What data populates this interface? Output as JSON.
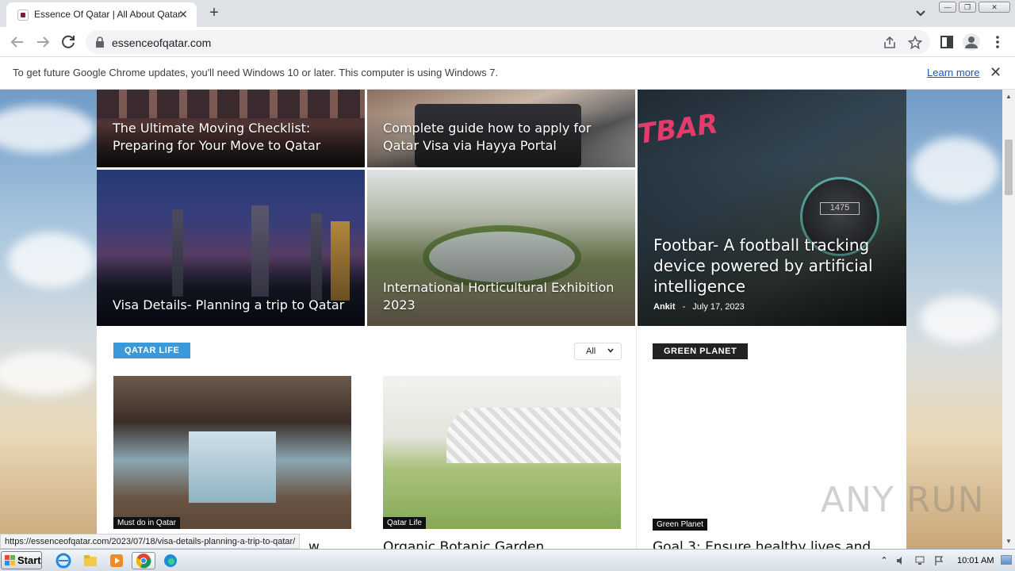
{
  "browser": {
    "tab": {
      "title": "Essence Of Qatar | All About Qatar",
      "close": "✕"
    },
    "new_tab": "+",
    "window_buttons": {
      "minimize": "—",
      "restore": "❐",
      "close": "✕"
    },
    "address": "essenceofqatar.com"
  },
  "infobar": {
    "message": "To get future Google Chrome updates, you'll need Windows 10 or later. This computer is using Windows 7.",
    "link": "Learn more",
    "close": "✕"
  },
  "featured": [
    {
      "title": "The Ultimate Moving Checklist: Preparing for Your Move to Qatar"
    },
    {
      "title": "Complete guide how to apply for Qatar Visa via Hayya Portal"
    },
    {
      "title": "Footbar- A football tracking device powered by artificial intelligence",
      "author": "Ankit",
      "sep": "-",
      "date": "July 17, 2023",
      "photo_text_1": "TBAR",
      "photo_text_2": "1475"
    },
    {
      "title": "Visa Details- Planning a trip to Qatar"
    },
    {
      "title": "International Horticultural Exhibition 2023"
    }
  ],
  "qatar_life": {
    "badge": "QATAR LIFE",
    "filter": "All",
    "cards": [
      {
        "category": "Must do in Qatar",
        "title_partial": "…w"
      },
      {
        "category": "Qatar Life",
        "title_partial": "Organic Botanic Garden"
      }
    ]
  },
  "green_planet": {
    "badge": "GREEN PLANET",
    "card": {
      "category": "Green Planet",
      "title_partial": "Goal 3: Ensure healthy lives and"
    }
  },
  "status_url": "https://essenceofqatar.com/2023/07/18/visa-details-planning-a-trip-to-qatar/",
  "watermark": "ANY RUN",
  "taskbar": {
    "start": "Start",
    "time": "10:01 AM"
  },
  "colors": {
    "qatar_life_badge": "#3a9ad9",
    "green_planet_badge": "#222222",
    "link": "#1a55b8"
  }
}
